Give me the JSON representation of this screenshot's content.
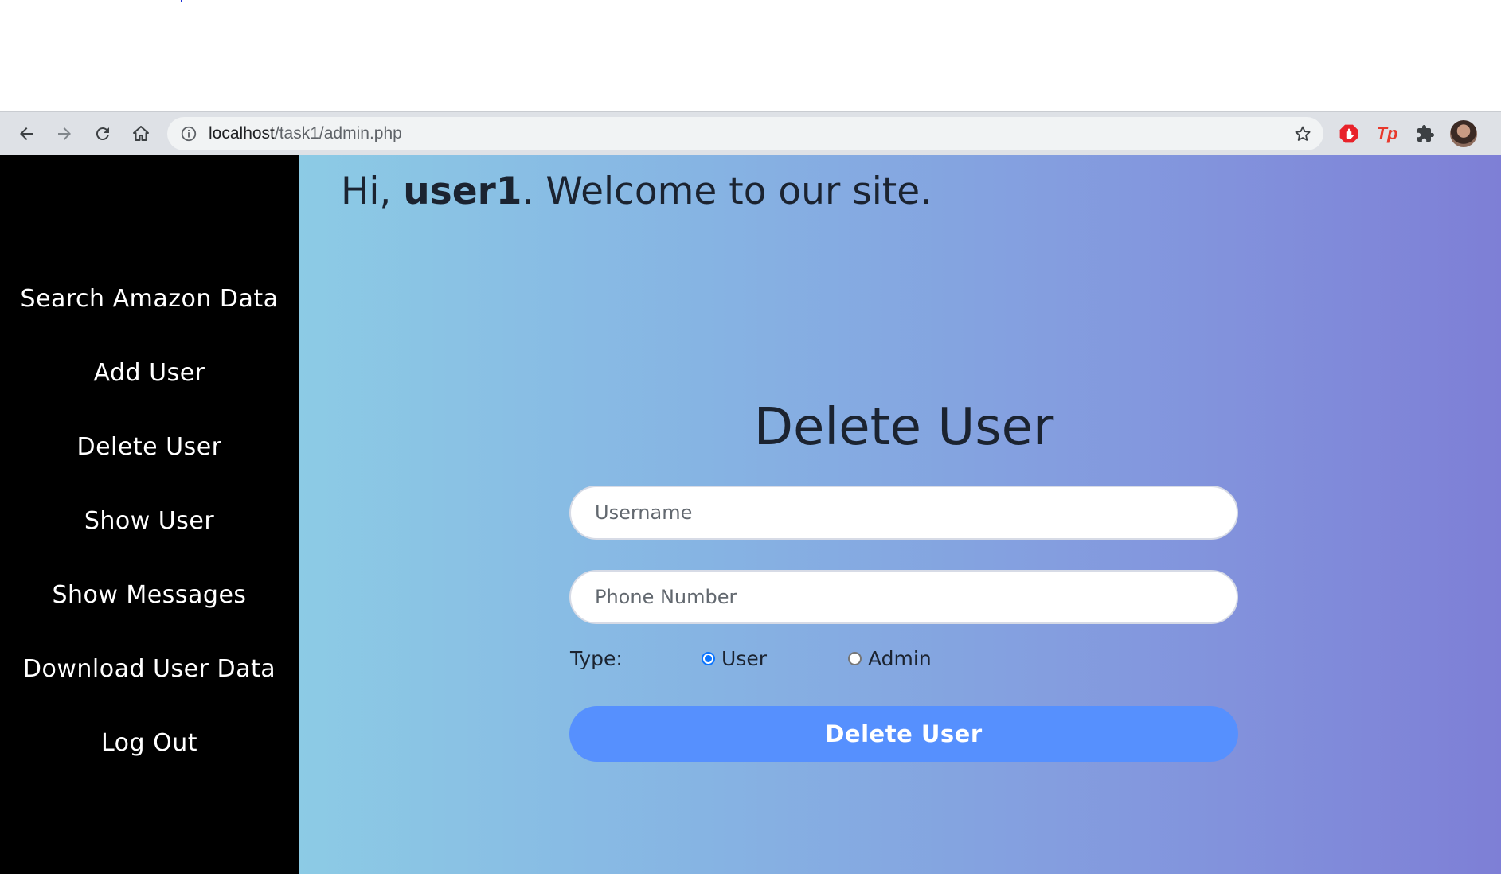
{
  "browser": {
    "url_host": "localhost",
    "url_path": "/task1/admin.php",
    "extensions": [
      {
        "name": "adblock-icon",
        "color": "#e8222a"
      },
      {
        "name": "tp-extension-icon",
        "label": "Tp",
        "color": "#e8392c"
      },
      {
        "name": "puzzle-icon"
      },
      {
        "name": "profile-avatar"
      }
    ]
  },
  "sidebar": {
    "items": [
      {
        "label": "Search Amazon Data"
      },
      {
        "label": "Add User"
      },
      {
        "label": "Delete User"
      },
      {
        "label": "Show User"
      },
      {
        "label": "Show Messages"
      },
      {
        "label": "Download User Data"
      },
      {
        "label": "Log Out"
      }
    ]
  },
  "main": {
    "greeting_prefix": "Hi, ",
    "username": "user1",
    "greeting_suffix": ". Welcome to our site.",
    "form": {
      "title": "Delete User",
      "username_placeholder": "Username",
      "phone_placeholder": "Phone Number",
      "type_label": "Type:",
      "type_options": [
        {
          "label": "User",
          "checked": true
        },
        {
          "label": "Admin",
          "checked": false
        }
      ],
      "submit_label": "Delete User"
    }
  },
  "colors": {
    "sidebar_bg": "#000000",
    "gradient_start": "#8ccbe5",
    "gradient_end": "#7e7fd6",
    "submit_bg": "#5690fe"
  }
}
